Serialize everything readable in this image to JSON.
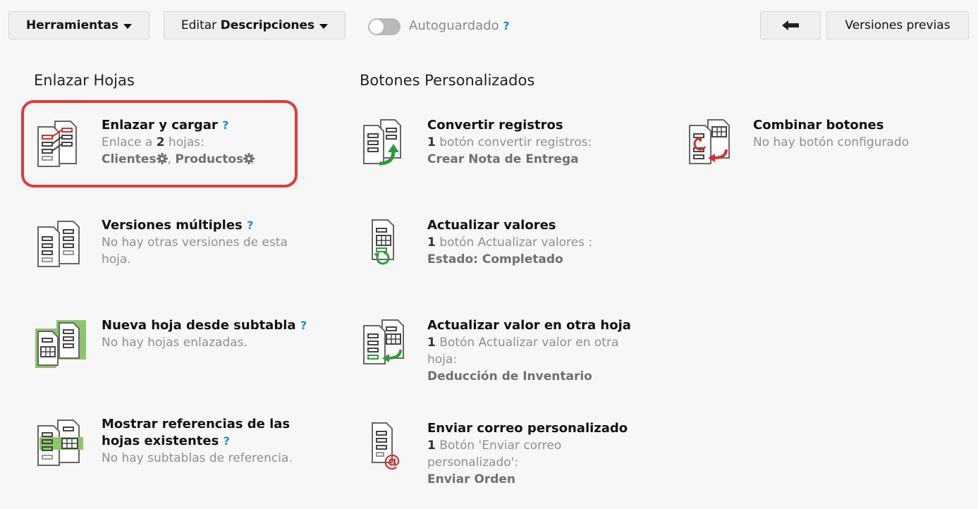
{
  "toolbar": {
    "tools_label": "Herramientas",
    "edit_prefix": "Editar",
    "edit_bold": "Descripciones",
    "autosave_label": "Autoguardado",
    "help": "?",
    "back_icon": "arrow-left-icon",
    "prev_versions": "Versiones previas"
  },
  "sections": {
    "link_sheets": "Enlazar Hojas",
    "custom_buttons": "Botones Personalizados"
  },
  "link_items": [
    {
      "title": "Enlazar y cargar",
      "desc_prefix": "Enlace a ",
      "count": "2",
      "desc_suffix": " hojas:",
      "sheets": [
        "Clientes",
        "Productos"
      ],
      "separator": ", "
    },
    {
      "title": "Versiones múltiples",
      "desc": "No hay otras versiones de esta hoja."
    },
    {
      "title": "Nueva hoja desde subtabla",
      "desc": "No hay hojas enlazadas."
    },
    {
      "title": "Mostrar referencias de las hojas existentes",
      "desc": "No hay subtablas de referencia."
    }
  ],
  "button_items": [
    {
      "title": "Convertir registros",
      "count": "1",
      "desc": " botón convertir registros:",
      "value": "Crear Nota de Entrega"
    },
    {
      "title": "Actualizar valores",
      "count": "1",
      "desc": " botón Actualizar valores :",
      "value": "Estado: Completado"
    },
    {
      "title": "Actualizar valor en otra hoja",
      "count": "1",
      "desc": " Botón Actualizar valor en otra hoja:",
      "value": "Deducción de Inventario"
    },
    {
      "title": "Enviar correo personalizado",
      "count": "1",
      "desc": " Botón 'Enviar correo personalizado':",
      "value": "Enviar Orden"
    }
  ],
  "combine": {
    "title": "Combinar botones",
    "desc": "No hay botón configurado"
  },
  "colors": {
    "accent_red": "#e23a3a",
    "help_blue": "#1a8fd0",
    "green": "#2e9a3a"
  }
}
